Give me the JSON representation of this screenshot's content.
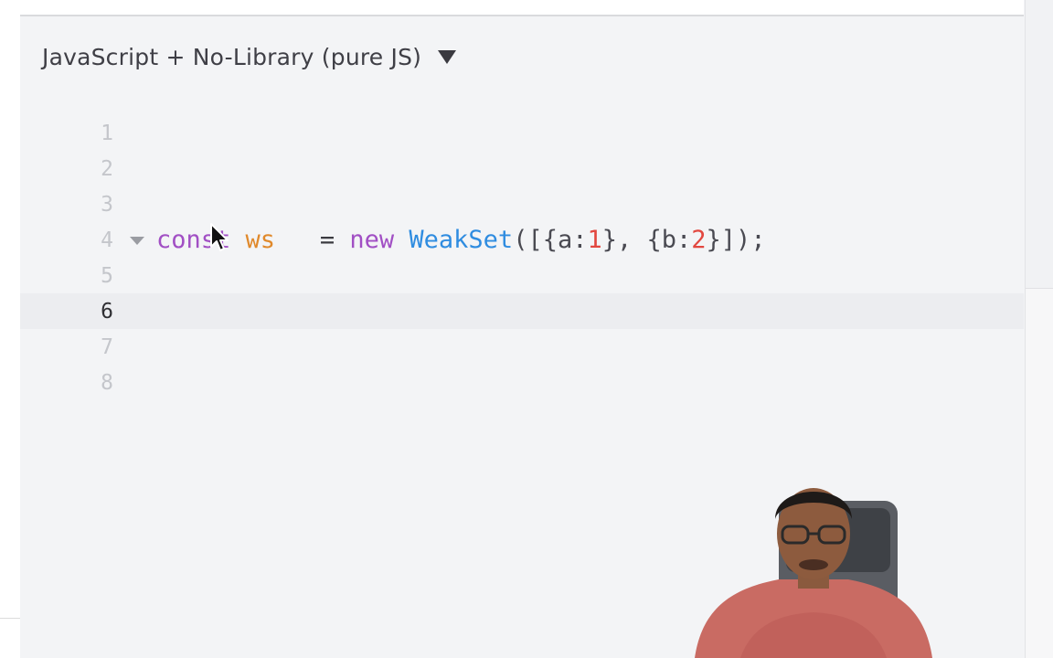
{
  "language_selector": {
    "label": "JavaScript + No-Library (pure JS)",
    "icon": "caret-down-icon"
  },
  "editor": {
    "active_line": 6,
    "lines": [
      {
        "number": "1",
        "tokens": []
      },
      {
        "number": "2",
        "tokens": []
      },
      {
        "number": "3",
        "tokens": []
      },
      {
        "number": "4",
        "fold": true,
        "tokens": [
          {
            "t": "const",
            "c": "keyword"
          },
          {
            "t": " ",
            "c": "op"
          },
          {
            "t": "ws",
            "c": "var"
          },
          {
            "t": "   = ",
            "c": "op"
          },
          {
            "t": "new",
            "c": "new"
          },
          {
            "t": " ",
            "c": "op"
          },
          {
            "t": "WeakSet",
            "c": "class"
          },
          {
            "t": "([{a:",
            "c": "punc"
          },
          {
            "t": "1",
            "c": "num"
          },
          {
            "t": "}, {b:",
            "c": "punc"
          },
          {
            "t": "2",
            "c": "num"
          },
          {
            "t": "}]);",
            "c": "punc"
          }
        ]
      },
      {
        "number": "5",
        "tokens": []
      },
      {
        "number": "6",
        "tokens": []
      },
      {
        "number": "7",
        "tokens": []
      },
      {
        "number": "8",
        "tokens": []
      }
    ]
  },
  "overlay": {
    "cursor_icon": "mouse-pointer-icon",
    "webcam": "presenter-webcam-video"
  },
  "colors": {
    "keyword": "#a14fc4",
    "variable": "#e0892b",
    "class": "#2f8ce0",
    "number": "#e2473f",
    "background": "#f3f4f6"
  }
}
